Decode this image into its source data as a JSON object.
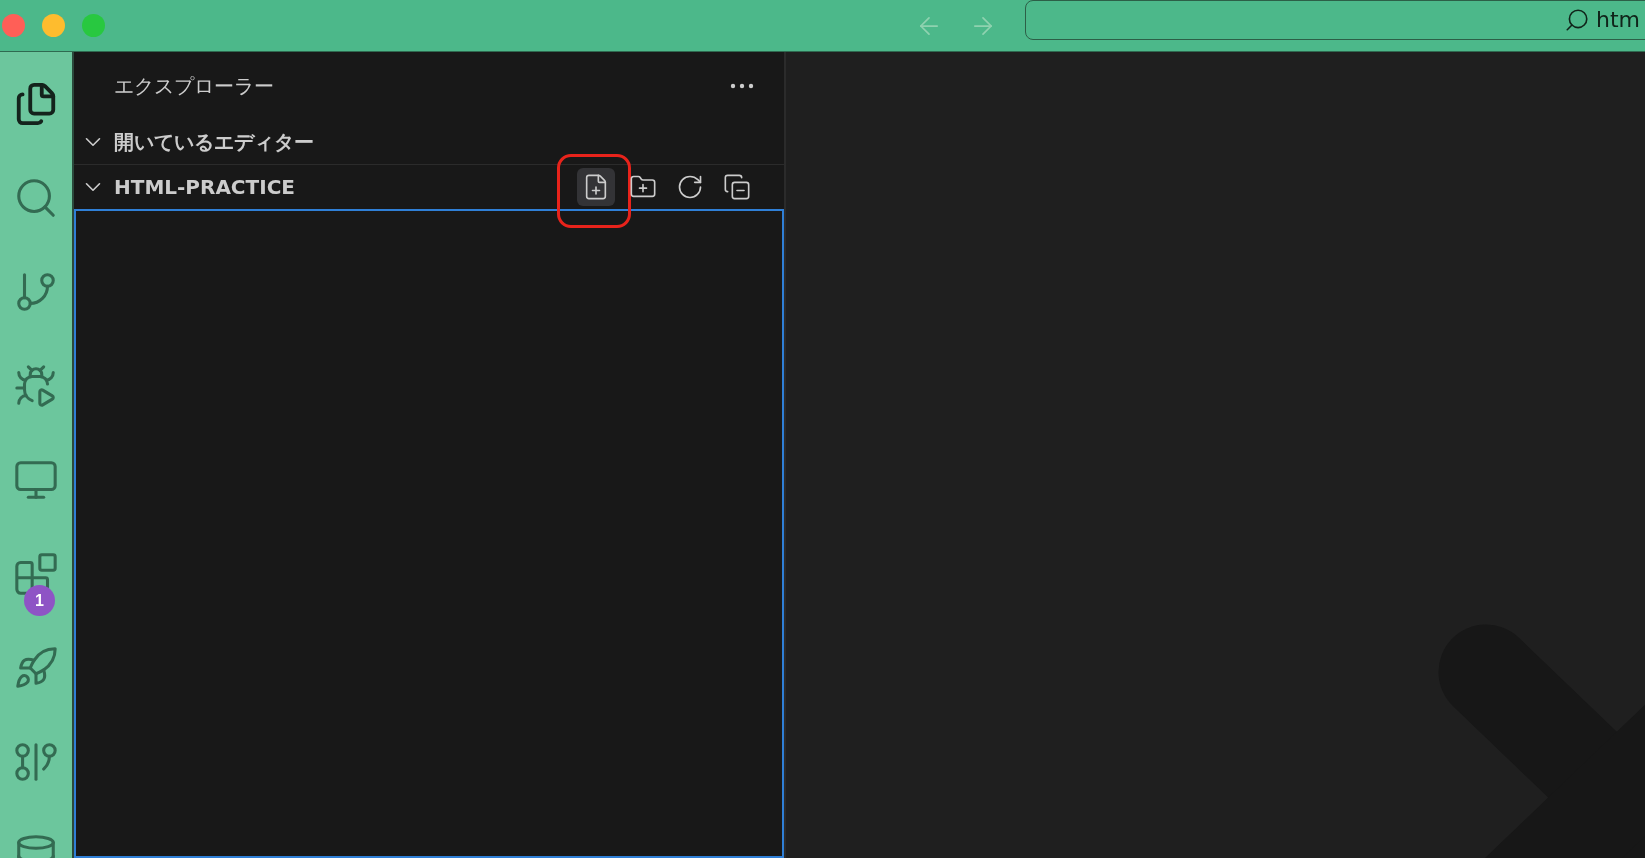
{
  "window": {
    "traffic_lights": [
      {
        "color": "#ff5f57"
      },
      {
        "color": "#febc2e"
      },
      {
        "color": "#28c840"
      }
    ]
  },
  "title_bar": {
    "search": {
      "value": "htm"
    }
  },
  "activity_bar": {
    "items": [
      {
        "kind": "files",
        "selected": true
      },
      {
        "kind": "search",
        "selected": false
      },
      {
        "kind": "source-control",
        "selected": false
      },
      {
        "kind": "run-debug",
        "selected": false
      },
      {
        "kind": "remote",
        "selected": false
      },
      {
        "kind": "extensions",
        "selected": false,
        "badge": "1"
      },
      {
        "kind": "rocket",
        "selected": false
      },
      {
        "kind": "git-graph",
        "selected": false
      },
      {
        "kind": "database",
        "selected": false
      }
    ]
  },
  "sidebar": {
    "title": "エクスプローラー",
    "sections": [
      {
        "title": "開いているエディター",
        "expanded": true
      },
      {
        "title": "HTML-PRACTICE",
        "expanded": true,
        "focused": true,
        "actions": [
          {
            "kind": "new-file",
            "highlighted": true
          },
          {
            "kind": "new-folder",
            "highlighted": false
          },
          {
            "kind": "refresh",
            "highlighted": false
          },
          {
            "kind": "collapse",
            "highlighted": false
          }
        ]
      }
    ]
  }
}
